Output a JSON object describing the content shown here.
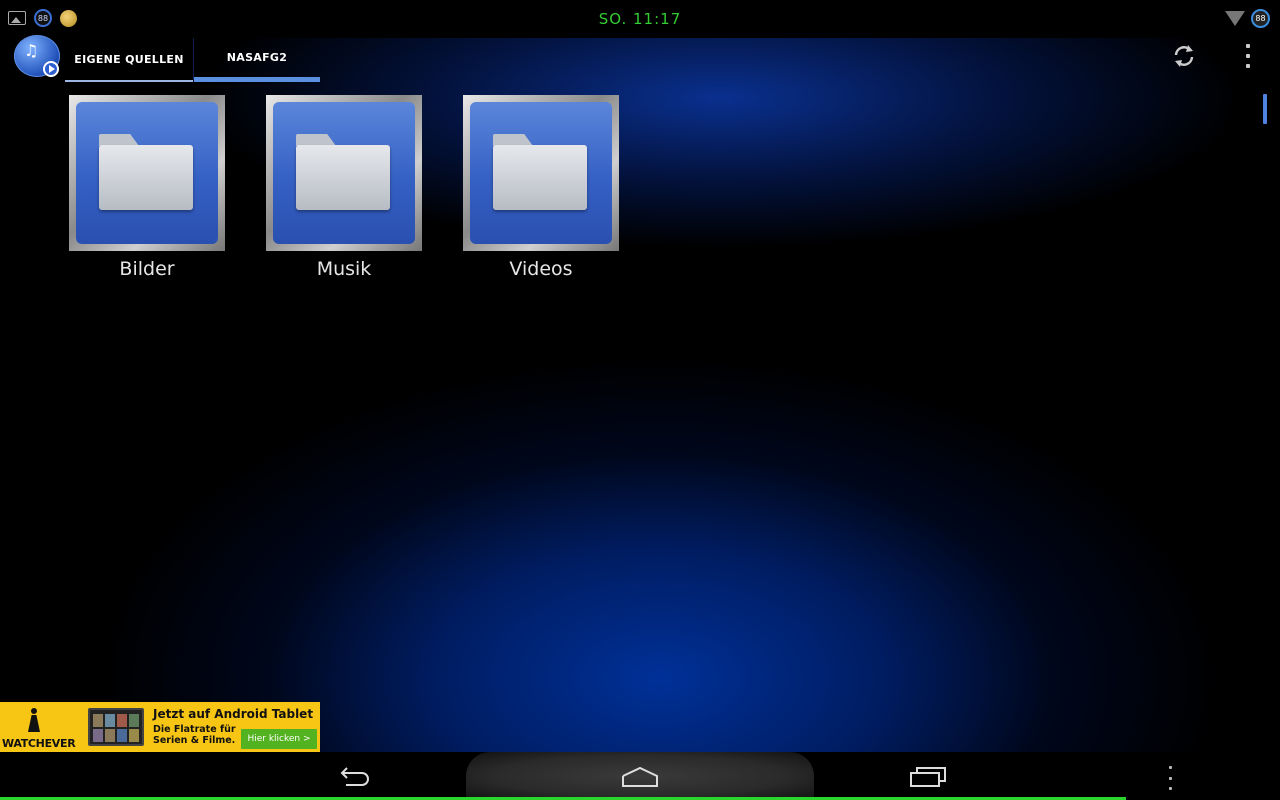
{
  "status_bar": {
    "time": "SO. 11:17",
    "notification_badge": "88",
    "battery_badge": "88",
    "time_color": "#33cc33"
  },
  "action_bar": {
    "tabs": [
      {
        "label": "EIGENE QUELLEN",
        "selected": false
      },
      {
        "label": "NASAFG2",
        "selected": true
      }
    ],
    "accent_color": "#5b8fe0"
  },
  "folders": [
    {
      "label": "Bilder"
    },
    {
      "label": "Musik"
    },
    {
      "label": "Videos"
    }
  ],
  "ad": {
    "brand": "WATCHEVER",
    "title": "Jetzt auf Android Tablet",
    "text_line1": "Die Flatrate für",
    "text_line2": "Serien & Filme.",
    "cta": "Hier klicken >"
  },
  "nav_bar": {
    "buttons": [
      "back",
      "home",
      "recent-apps",
      "menu"
    ]
  }
}
